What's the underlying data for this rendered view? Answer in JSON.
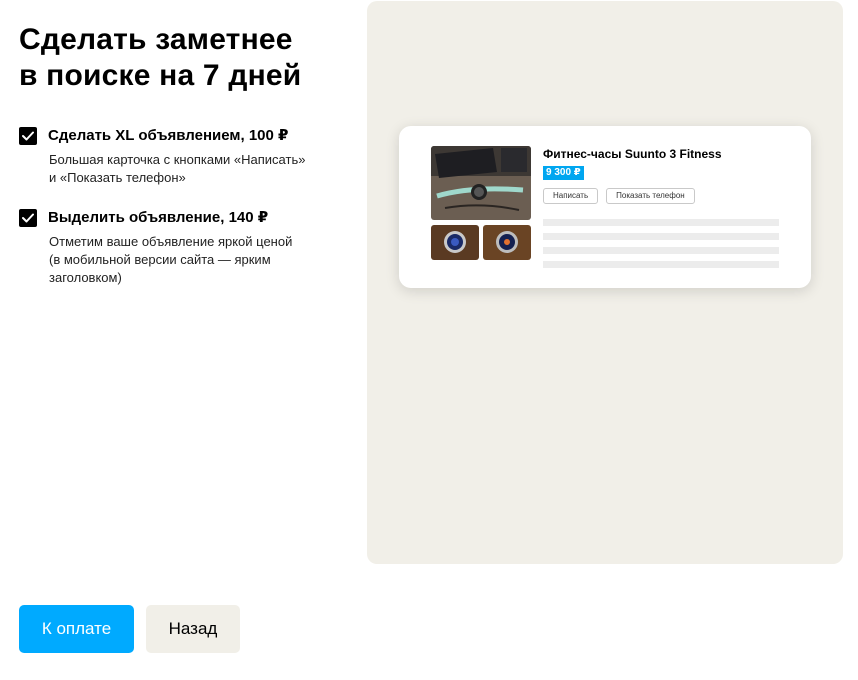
{
  "heading": "Сделать заметнее\nв поиске на 7 дней",
  "options": [
    {
      "checked": true,
      "label": "Сделать XL объявлением, 100 ₽",
      "description": "Большая карточка с кнопками «Написать»\nи «Показать телефон»"
    },
    {
      "checked": true,
      "label": "Выделить объявление, 140 ₽",
      "description": "Отметим ваше объявление яркой ценой\n(в мобильной версии сайта — ярким\nзаголовком)"
    }
  ],
  "preview": {
    "title": "Фитнес-часы Suunto 3 Fitness",
    "price": "9 300 ₽",
    "write_button": "Написать",
    "show_phone_button": "Показать телефон",
    "price_color": "#00a6f0"
  },
  "footer": {
    "pay_button": "К оплате",
    "back_button": "Назад",
    "accent_color": "#00aaff"
  }
}
